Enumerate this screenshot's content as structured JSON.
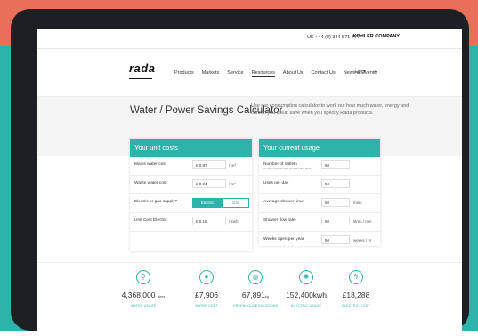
{
  "topbar": {
    "phone": "UK +44 (0) 344 571 7777",
    "brand": "KOHLER COMPANY"
  },
  "logo": "rada",
  "nav": {
    "items": [
      {
        "label": "Products"
      },
      {
        "label": "Markets"
      },
      {
        "label": "Service"
      },
      {
        "label": "Resources"
      },
      {
        "label": "About Us"
      },
      {
        "label": "Contact Us"
      },
      {
        "label": "News & Events"
      }
    ],
    "lang": "EN ▾",
    "search_icon": "search-icon"
  },
  "hero": {
    "title": "Water / Power Savings Calculator",
    "intro": "Use our consumption calculator to work out how much water, energy and carbon you could save when you specify Rada products."
  },
  "unit_costs": {
    "header": "Your unit costs",
    "rows": [
      {
        "label": "Mains water cost",
        "value": "£ 0.87",
        "unit": "/ m³"
      },
      {
        "label": "Waste water cost",
        "value": "£ 0.94",
        "unit": "/ m³"
      },
      {
        "label": "Electric or gas supply?",
        "electric": "Electric",
        "gas": "Gas"
      },
      {
        "label": "Unit Cost Electric",
        "value": "£ 0.15",
        "unit": "/ kwh"
      }
    ]
  },
  "usage": {
    "header": "Your current usage",
    "rows": [
      {
        "label": "Number of outlets",
        "note": "(in total count of both showers and taps)",
        "value": "50",
        "unit": ""
      },
      {
        "label": "Uses per day",
        "value": "50",
        "unit": ""
      },
      {
        "label": "Average shower time",
        "value": "50",
        "unit": "mins"
      },
      {
        "label": "Shower flow rate",
        "value": "50",
        "unit": "litres / min"
      },
      {
        "label": "Weeks open per year",
        "value": "50",
        "unit": "weeks / yr"
      }
    ]
  },
  "stats": [
    {
      "icon": "tap-icon",
      "glyph": "⚲",
      "value": "4,368,000",
      "unit": "litres",
      "caption": "WATER USAGE"
    },
    {
      "icon": "drop-icon",
      "glyph": "●",
      "value": "£7,906",
      "unit": "",
      "caption": "WATER COST"
    },
    {
      "icon": "globe-icon",
      "glyph": "◍",
      "value": "67,891",
      "unit": "kg",
      "caption": "GREENHOUSE EMISSIONS"
    },
    {
      "icon": "bulb-icon",
      "glyph": "✺",
      "value": "152,400kwh",
      "unit": "",
      "caption": "ELECTRIC USAGE"
    },
    {
      "icon": "bolt-icon",
      "glyph": "ϟ",
      "value": "£18,288",
      "unit": "",
      "caption": "ELECTRIC COST"
    }
  ]
}
